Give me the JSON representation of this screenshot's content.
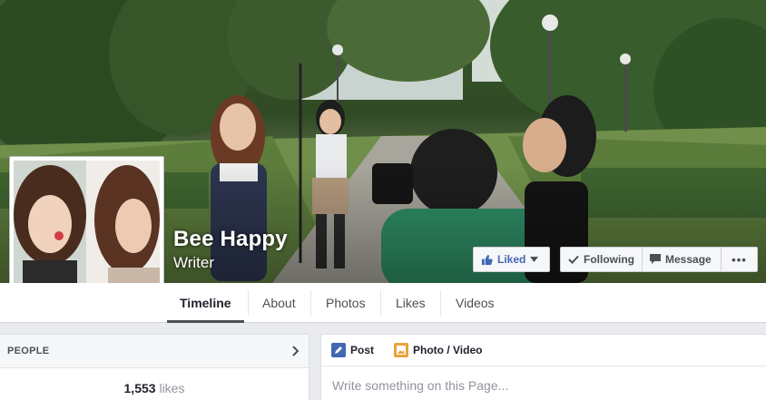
{
  "page": {
    "name": "Bee Happy",
    "category": "Writer"
  },
  "actions": {
    "liked_label": "Liked",
    "following_label": "Following",
    "message_label": "Message",
    "more_label": "•••"
  },
  "nav": {
    "tabs": [
      {
        "label": "Timeline",
        "active": true
      },
      {
        "label": "About"
      },
      {
        "label": "Photos"
      },
      {
        "label": "Likes"
      },
      {
        "label": "Videos"
      }
    ]
  },
  "people": {
    "title": "PEOPLE",
    "likes_count": "1,553",
    "likes_word": "likes"
  },
  "composer": {
    "post_label": "Post",
    "photo_label": "Photo / Video",
    "placeholder": "Write something on this Page..."
  },
  "colors": {
    "accent": "#4267b2",
    "background": "#e9ebee"
  }
}
